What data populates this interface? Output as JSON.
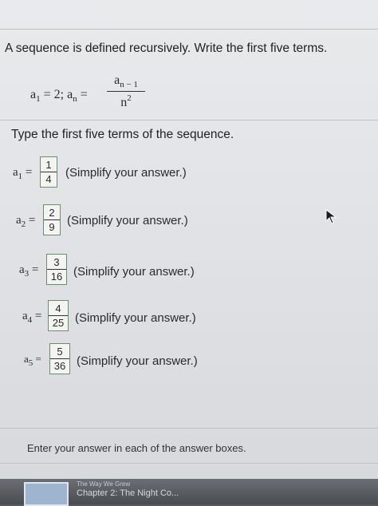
{
  "question": {
    "intro": "A sequence is defined recursively. Write the first five terms.",
    "definition": {
      "a1_text": "a",
      "a1_sub": "1",
      "a1_value": " = 2;  a",
      "an_sub": "n",
      "equals": " =",
      "numerator_base": "a",
      "numerator_sub": "n − 1",
      "denominator_base": "n",
      "denominator_sup": "2"
    },
    "prompt": "Type the first five terms of the sequence."
  },
  "answers": [
    {
      "label": "a",
      "index": "1",
      "eq": " =",
      "numerator": "1",
      "denominator": "4",
      "hint": "(Simplify your answer.)"
    },
    {
      "label": "a",
      "index": "2",
      "eq": " =",
      "numerator": "2",
      "denominator": "9",
      "hint": "(Simplify your answer.)"
    },
    {
      "label": "a",
      "index": "3",
      "eq": " =",
      "numerator": "3",
      "denominator": "16",
      "hint": "(Simplify your answer.)"
    },
    {
      "label": "a",
      "index": "4",
      "eq": " =",
      "numerator": "4",
      "denominator": "25",
      "hint": "(Simplify your answer.)"
    },
    {
      "label": "a",
      "index": "5",
      "eq": " =",
      "numerator": "5",
      "denominator": "36",
      "hint": "(Simplify your answer.)"
    }
  ],
  "footer": "Enter your answer in each of the answer boxes.",
  "taskbar": {
    "item_text": "Chapter 2: The Night Co...",
    "top_text": "The Way We Grew"
  },
  "colors": {
    "screen_bg": "#e6e7ea",
    "answer_box_border": "#6b8f6b",
    "taskbar_bg": "#55585e"
  }
}
